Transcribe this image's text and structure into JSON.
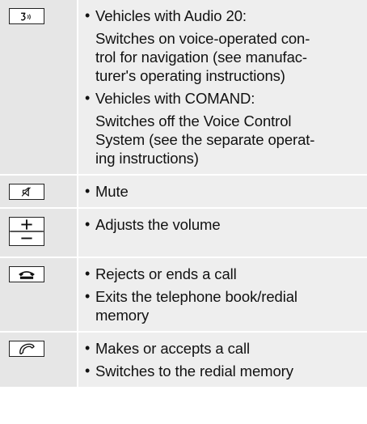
{
  "rows": [
    {
      "key_icon": "voice-control-icon",
      "items": [
        {
          "paras": [
            [
              "Vehicles with Audio 20:"
            ],
            [
              "Switches on voice-operated con-",
              "trol for navigation (see manufac-",
              "turer's operating instructions)"
            ]
          ]
        },
        {
          "paras": [
            [
              "Vehicles with COMAND:"
            ],
            [
              "Switches off the Voice Control",
              "System (see the separate operat-",
              "ing instructions)"
            ]
          ]
        }
      ]
    },
    {
      "key_icon": "mute-icon",
      "items": [
        {
          "paras": [
            [
              "Mute"
            ]
          ]
        }
      ]
    },
    {
      "key_icon": "volume-plus-minus-icon",
      "items": [
        {
          "paras": [
            [
              "Adjusts the volume"
            ]
          ]
        }
      ]
    },
    {
      "key_icon": "end-call-icon",
      "items": [
        {
          "paras": [
            [
              "Rejects or ends a call"
            ]
          ]
        },
        {
          "paras": [
            [
              "Exits the telephone book/redial",
              "memory"
            ]
          ]
        }
      ]
    },
    {
      "key_icon": "accept-call-icon",
      "items": [
        {
          "paras": [
            [
              "Makes or accepts a call"
            ]
          ]
        },
        {
          "paras": [
            [
              "Switches to the redial memory"
            ]
          ]
        }
      ]
    }
  ],
  "bullet_glyph": "•",
  "colors": {
    "key_column_bg": "#e6e6e6",
    "text_column_bg": "#eeeeee",
    "separator": "#ffffff"
  }
}
